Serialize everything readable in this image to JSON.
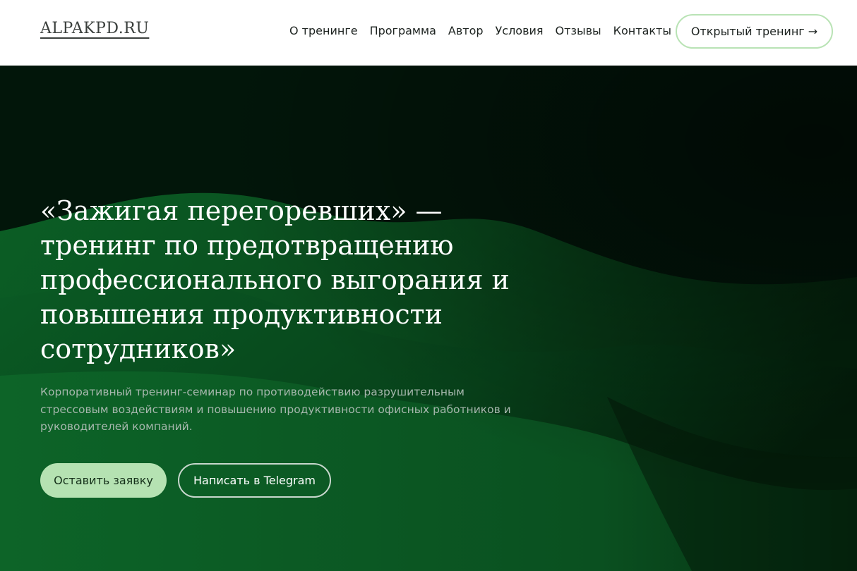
{
  "header": {
    "logo": "ALPAKPD.RU",
    "nav": [
      "О тренинге",
      "Программа",
      "Автор",
      "Условия",
      "Отзывы",
      "Контакты"
    ],
    "cta": "Открытый тренинг →"
  },
  "hero": {
    "title": "«Зажигая перегоревших» —\nтренинг по предотвращению\nпрофессионального выгорания и\nповышения продуктивности\nсотрудников»",
    "subtitle": "Корпоративный тренинг-семинар по противодействию разрушительным стрессовым воздействиям и повышению продуктивности офисных работников и руководителей компаний.",
    "primary_button": "Оставить заявку",
    "secondary_button": "Написать в Telegram"
  },
  "colors": {
    "accent_light_green": "#b5e2b2",
    "hero_dark": "#021408",
    "hero_green": "#0b5a22"
  }
}
